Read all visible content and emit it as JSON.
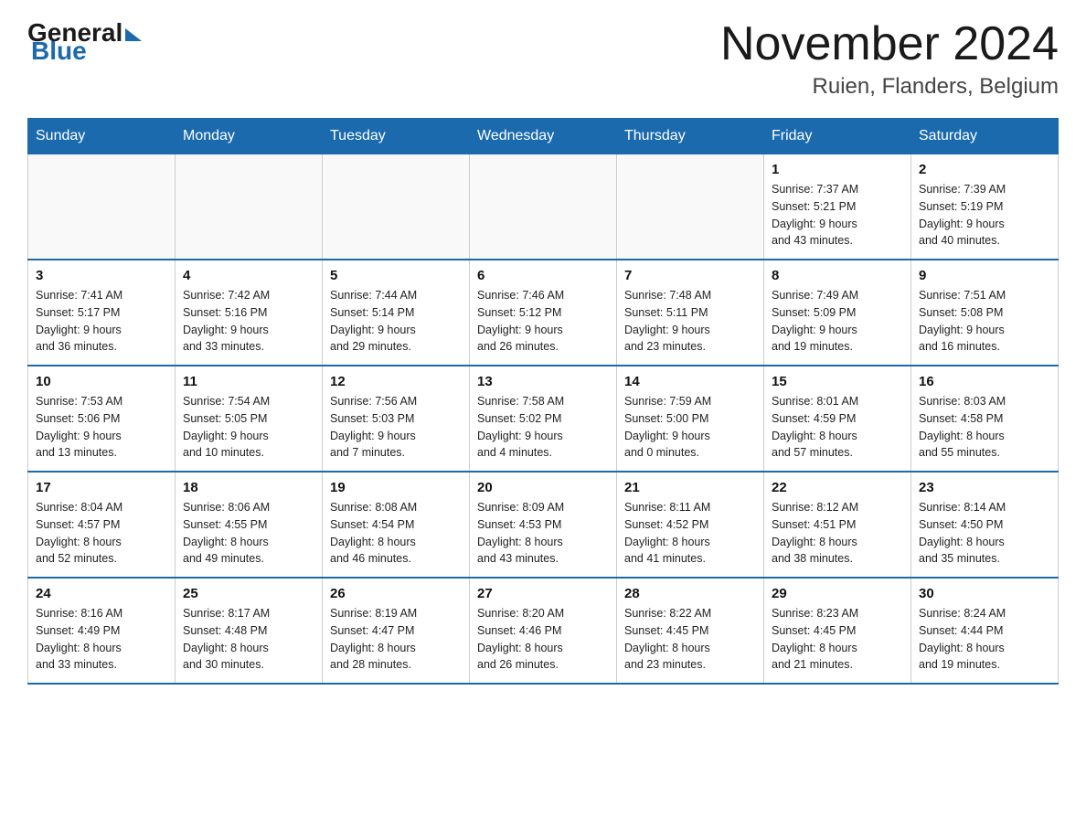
{
  "header": {
    "logo_general": "General",
    "logo_blue": "Blue",
    "month_year": "November 2024",
    "location": "Ruien, Flanders, Belgium"
  },
  "days_of_week": [
    "Sunday",
    "Monday",
    "Tuesday",
    "Wednesday",
    "Thursday",
    "Friday",
    "Saturday"
  ],
  "weeks": [
    [
      {
        "day": "",
        "info": ""
      },
      {
        "day": "",
        "info": ""
      },
      {
        "day": "",
        "info": ""
      },
      {
        "day": "",
        "info": ""
      },
      {
        "day": "",
        "info": ""
      },
      {
        "day": "1",
        "info": "Sunrise: 7:37 AM\nSunset: 5:21 PM\nDaylight: 9 hours\nand 43 minutes."
      },
      {
        "day": "2",
        "info": "Sunrise: 7:39 AM\nSunset: 5:19 PM\nDaylight: 9 hours\nand 40 minutes."
      }
    ],
    [
      {
        "day": "3",
        "info": "Sunrise: 7:41 AM\nSunset: 5:17 PM\nDaylight: 9 hours\nand 36 minutes."
      },
      {
        "day": "4",
        "info": "Sunrise: 7:42 AM\nSunset: 5:16 PM\nDaylight: 9 hours\nand 33 minutes."
      },
      {
        "day": "5",
        "info": "Sunrise: 7:44 AM\nSunset: 5:14 PM\nDaylight: 9 hours\nand 29 minutes."
      },
      {
        "day": "6",
        "info": "Sunrise: 7:46 AM\nSunset: 5:12 PM\nDaylight: 9 hours\nand 26 minutes."
      },
      {
        "day": "7",
        "info": "Sunrise: 7:48 AM\nSunset: 5:11 PM\nDaylight: 9 hours\nand 23 minutes."
      },
      {
        "day": "8",
        "info": "Sunrise: 7:49 AM\nSunset: 5:09 PM\nDaylight: 9 hours\nand 19 minutes."
      },
      {
        "day": "9",
        "info": "Sunrise: 7:51 AM\nSunset: 5:08 PM\nDaylight: 9 hours\nand 16 minutes."
      }
    ],
    [
      {
        "day": "10",
        "info": "Sunrise: 7:53 AM\nSunset: 5:06 PM\nDaylight: 9 hours\nand 13 minutes."
      },
      {
        "day": "11",
        "info": "Sunrise: 7:54 AM\nSunset: 5:05 PM\nDaylight: 9 hours\nand 10 minutes."
      },
      {
        "day": "12",
        "info": "Sunrise: 7:56 AM\nSunset: 5:03 PM\nDaylight: 9 hours\nand 7 minutes."
      },
      {
        "day": "13",
        "info": "Sunrise: 7:58 AM\nSunset: 5:02 PM\nDaylight: 9 hours\nand 4 minutes."
      },
      {
        "day": "14",
        "info": "Sunrise: 7:59 AM\nSunset: 5:00 PM\nDaylight: 9 hours\nand 0 minutes."
      },
      {
        "day": "15",
        "info": "Sunrise: 8:01 AM\nSunset: 4:59 PM\nDaylight: 8 hours\nand 57 minutes."
      },
      {
        "day": "16",
        "info": "Sunrise: 8:03 AM\nSunset: 4:58 PM\nDaylight: 8 hours\nand 55 minutes."
      }
    ],
    [
      {
        "day": "17",
        "info": "Sunrise: 8:04 AM\nSunset: 4:57 PM\nDaylight: 8 hours\nand 52 minutes."
      },
      {
        "day": "18",
        "info": "Sunrise: 8:06 AM\nSunset: 4:55 PM\nDaylight: 8 hours\nand 49 minutes."
      },
      {
        "day": "19",
        "info": "Sunrise: 8:08 AM\nSunset: 4:54 PM\nDaylight: 8 hours\nand 46 minutes."
      },
      {
        "day": "20",
        "info": "Sunrise: 8:09 AM\nSunset: 4:53 PM\nDaylight: 8 hours\nand 43 minutes."
      },
      {
        "day": "21",
        "info": "Sunrise: 8:11 AM\nSunset: 4:52 PM\nDaylight: 8 hours\nand 41 minutes."
      },
      {
        "day": "22",
        "info": "Sunrise: 8:12 AM\nSunset: 4:51 PM\nDaylight: 8 hours\nand 38 minutes."
      },
      {
        "day": "23",
        "info": "Sunrise: 8:14 AM\nSunset: 4:50 PM\nDaylight: 8 hours\nand 35 minutes."
      }
    ],
    [
      {
        "day": "24",
        "info": "Sunrise: 8:16 AM\nSunset: 4:49 PM\nDaylight: 8 hours\nand 33 minutes."
      },
      {
        "day": "25",
        "info": "Sunrise: 8:17 AM\nSunset: 4:48 PM\nDaylight: 8 hours\nand 30 minutes."
      },
      {
        "day": "26",
        "info": "Sunrise: 8:19 AM\nSunset: 4:47 PM\nDaylight: 8 hours\nand 28 minutes."
      },
      {
        "day": "27",
        "info": "Sunrise: 8:20 AM\nSunset: 4:46 PM\nDaylight: 8 hours\nand 26 minutes."
      },
      {
        "day": "28",
        "info": "Sunrise: 8:22 AM\nSunset: 4:45 PM\nDaylight: 8 hours\nand 23 minutes."
      },
      {
        "day": "29",
        "info": "Sunrise: 8:23 AM\nSunset: 4:45 PM\nDaylight: 8 hours\nand 21 minutes."
      },
      {
        "day": "30",
        "info": "Sunrise: 8:24 AM\nSunset: 4:44 PM\nDaylight: 8 hours\nand 19 minutes."
      }
    ]
  ]
}
